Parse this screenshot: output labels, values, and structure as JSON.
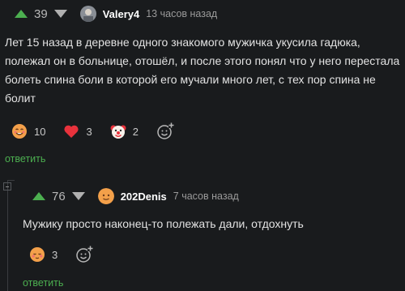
{
  "comment1": {
    "score": "39",
    "author": "Valery4",
    "time": "13 часов назад",
    "text": "Лет 15 назад в деревне одного знакомого мужичка укусила гадюка, полежал он в больнице, отошёл, и после этого понял что у него перестала болеть спина боли в которой его мучали много лет, с тех пор спина не болит",
    "reactions": [
      {
        "icon": "smiling-face-icon",
        "count": "10"
      },
      {
        "icon": "heart-icon",
        "count": "3"
      },
      {
        "icon": "clown-face-icon",
        "count": "2"
      }
    ],
    "reply_label": "ответить"
  },
  "comment2": {
    "score": "76",
    "author": "202Denis",
    "time": "7 часов назад",
    "text": "Мужику просто наконец-то полежать дали, отдохнуть",
    "reactions": [
      {
        "icon": "blushing-face-icon",
        "count": "3"
      }
    ],
    "reply_label": "ответить"
  },
  "colors": {
    "background": "#191b1d",
    "accent_green": "#4caf50",
    "text": "#e2e2e2",
    "muted": "#9a9a9a"
  }
}
